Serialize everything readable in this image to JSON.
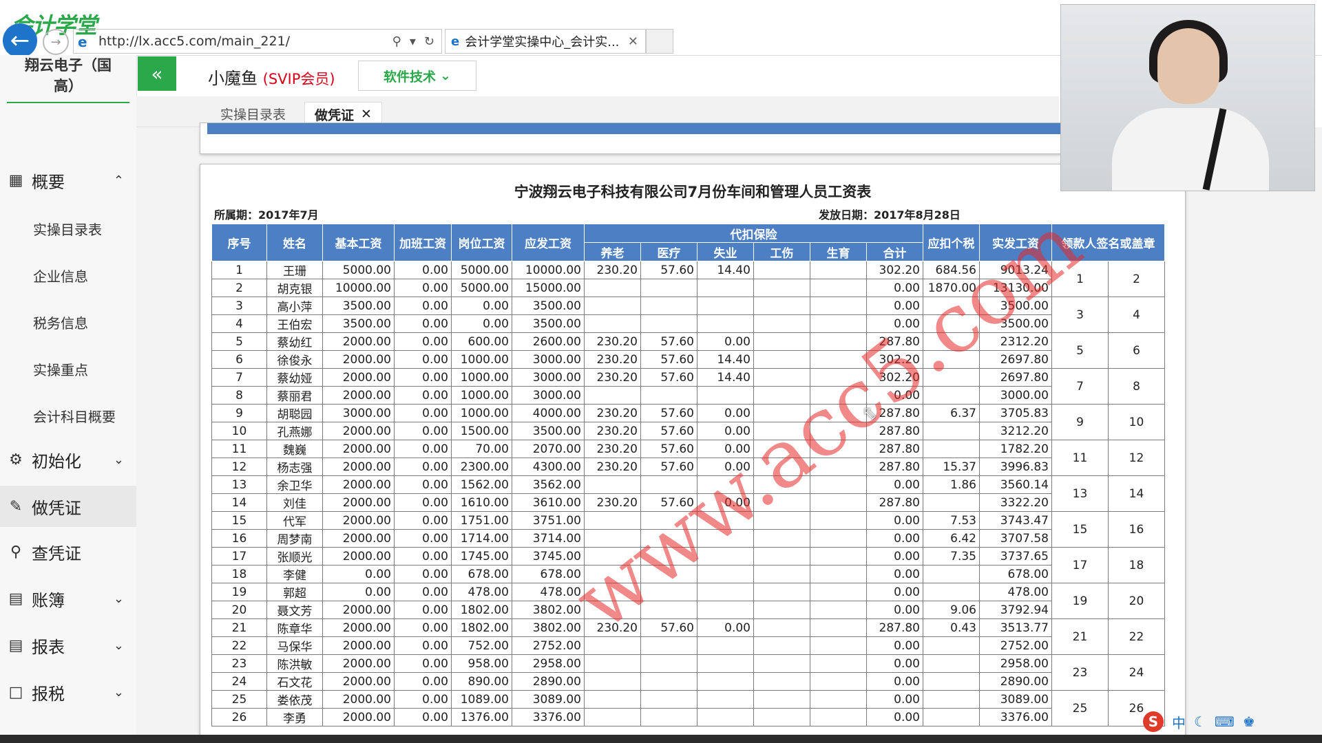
{
  "browser": {
    "logo_text": "会计学堂",
    "url": "http://lx.acc5.com/main_221/",
    "tab_title": "会计学堂实操中心_会计实...",
    "tab_close": "✕"
  },
  "sidebar": {
    "company_line1": "翔云电子（国",
    "company_line2": "高）",
    "groups": [
      {
        "label": "概要",
        "icon": "grid-icon"
      },
      {
        "label": "初始化",
        "icon": "gear-icon"
      },
      {
        "label": "做凭证",
        "icon": "pen-icon"
      },
      {
        "label": "查凭证",
        "icon": "search-icon"
      },
      {
        "label": "账簿",
        "icon": "ledger-icon"
      },
      {
        "label": "报表",
        "icon": "report-icon"
      },
      {
        "label": "报税",
        "icon": "file-icon"
      }
    ],
    "sub_items": [
      "实操目录表",
      "企业信息",
      "税务信息",
      "实操重点",
      "会计科目概要"
    ]
  },
  "header": {
    "username": "小魔鱼",
    "vip": "(SVIP会员)",
    "tech_button": "软件技术"
  },
  "tabs": {
    "catalog": "实操目录表",
    "voucher": "做凭证"
  },
  "sheet": {
    "title": "宁波翔云电子科技有限公司7月份车间和管理人员工资表",
    "period": "所属期：2017年7月",
    "pay_date": "发放日期：2017年8月28日",
    "headers": {
      "seq": "序号",
      "name": "姓名",
      "base": "基本工资",
      "overtime": "加班工资",
      "post": "岗位工资",
      "gross": "应发工资",
      "insurance": "代扣保险",
      "pension": "养老",
      "medical": "医疗",
      "unemployment": "失业",
      "injury": "工伤",
      "maternity": "生育",
      "total": "合计",
      "tax": "应扣个税",
      "net": "实发工资",
      "sign": "领款人签名或盖章"
    },
    "rows": [
      [
        "1",
        "王珊",
        "5000.00",
        "0.00",
        "5000.00",
        "10000.00",
        "230.20",
        "57.60",
        "14.40",
        "",
        "",
        "302.20",
        "684.56",
        "9013.24"
      ],
      [
        "2",
        "胡克银",
        "10000.00",
        "0.00",
        "5000.00",
        "15000.00",
        "",
        "",
        "",
        "",
        "",
        "0.00",
        "1870.00",
        "13130.00"
      ],
      [
        "3",
        "高小萍",
        "3500.00",
        "0.00",
        "0.00",
        "3500.00",
        "",
        "",
        "",
        "",
        "",
        "0.00",
        "",
        "3500.00"
      ],
      [
        "4",
        "王伯宏",
        "3500.00",
        "0.00",
        "0.00",
        "3500.00",
        "",
        "",
        "",
        "",
        "",
        "0.00",
        "",
        "3500.00"
      ],
      [
        "5",
        "蔡幼红",
        "2000.00",
        "0.00",
        "600.00",
        "2600.00",
        "230.20",
        "57.60",
        "0.00",
        "",
        "",
        "287.80",
        "",
        "2312.20"
      ],
      [
        "6",
        "徐俊永",
        "2000.00",
        "0.00",
        "1000.00",
        "3000.00",
        "230.20",
        "57.60",
        "14.40",
        "",
        "",
        "302.20",
        "",
        "2697.80"
      ],
      [
        "7",
        "蔡幼娅",
        "2000.00",
        "0.00",
        "1000.00",
        "3000.00",
        "230.20",
        "57.60",
        "14.40",
        "",
        "",
        "302.20",
        "",
        "2697.80"
      ],
      [
        "8",
        "蔡丽君",
        "2000.00",
        "0.00",
        "1000.00",
        "3000.00",
        "",
        "",
        "",
        "",
        "",
        "0.00",
        "",
        "3000.00"
      ],
      [
        "9",
        "胡聪园",
        "3000.00",
        "0.00",
        "1000.00",
        "4000.00",
        "230.20",
        "57.60",
        "0.00",
        "",
        "",
        "287.80",
        "6.37",
        "3705.83"
      ],
      [
        "10",
        "孔燕娜",
        "2000.00",
        "0.00",
        "1500.00",
        "3500.00",
        "230.20",
        "57.60",
        "0.00",
        "",
        "",
        "287.80",
        "",
        "3212.20"
      ],
      [
        "11",
        "魏巍",
        "2000.00",
        "0.00",
        "70.00",
        "2070.00",
        "230.20",
        "57.60",
        "0.00",
        "",
        "",
        "287.80",
        "",
        "1782.20"
      ],
      [
        "12",
        "杨志强",
        "2000.00",
        "0.00",
        "2300.00",
        "4300.00",
        "230.20",
        "57.60",
        "0.00",
        "",
        "",
        "287.80",
        "15.37",
        "3996.83"
      ],
      [
        "13",
        "余卫华",
        "2000.00",
        "0.00",
        "1562.00",
        "3562.00",
        "",
        "",
        "",
        "",
        "",
        "0.00",
        "1.86",
        "3560.14"
      ],
      [
        "14",
        "刘佳",
        "2000.00",
        "0.00",
        "1610.00",
        "3610.00",
        "230.20",
        "57.60",
        "0.00",
        "",
        "",
        "287.80",
        "",
        "3322.20"
      ],
      [
        "15",
        "代军",
        "2000.00",
        "0.00",
        "1751.00",
        "3751.00",
        "",
        "",
        "",
        "",
        "",
        "0.00",
        "7.53",
        "3743.47"
      ],
      [
        "16",
        "周梦南",
        "2000.00",
        "0.00",
        "1714.00",
        "3714.00",
        "",
        "",
        "",
        "",
        "",
        "0.00",
        "6.42",
        "3707.58"
      ],
      [
        "17",
        "张顺光",
        "2000.00",
        "0.00",
        "1745.00",
        "3745.00",
        "",
        "",
        "",
        "",
        "",
        "0.00",
        "7.35",
        "3737.65"
      ],
      [
        "18",
        "李健",
        "0.00",
        "0.00",
        "678.00",
        "678.00",
        "",
        "",
        "",
        "",
        "",
        "0.00",
        "",
        "678.00"
      ],
      [
        "19",
        "郭超",
        "0.00",
        "0.00",
        "478.00",
        "478.00",
        "",
        "",
        "",
        "",
        "",
        "0.00",
        "",
        "478.00"
      ],
      [
        "20",
        "聂文芳",
        "2000.00",
        "0.00",
        "1802.00",
        "3802.00",
        "",
        "",
        "",
        "",
        "",
        "0.00",
        "9.06",
        "3792.94"
      ],
      [
        "21",
        "陈章华",
        "2000.00",
        "0.00",
        "1802.00",
        "3802.00",
        "230.20",
        "57.60",
        "0.00",
        "",
        "",
        "287.80",
        "0.43",
        "3513.77"
      ],
      [
        "22",
        "马保华",
        "2000.00",
        "0.00",
        "752.00",
        "2752.00",
        "",
        "",
        "",
        "",
        "",
        "0.00",
        "",
        "2752.00"
      ],
      [
        "23",
        "陈洪敏",
        "2000.00",
        "0.00",
        "958.00",
        "2958.00",
        "",
        "",
        "",
        "",
        "",
        "0.00",
        "",
        "2958.00"
      ],
      [
        "24",
        "石文花",
        "2000.00",
        "0.00",
        "890.00",
        "2890.00",
        "",
        "",
        "",
        "",
        "",
        "0.00",
        "",
        "2890.00"
      ],
      [
        "25",
        "娄依茂",
        "2000.00",
        "0.00",
        "1089.00",
        "3089.00",
        "",
        "",
        "",
        "",
        "",
        "0.00",
        "",
        "3089.00"
      ],
      [
        "26",
        "李勇",
        "2000.00",
        "0.00",
        "1376.00",
        "3376.00",
        "",
        "",
        "",
        "",
        "",
        "0.00",
        "",
        "3376.00"
      ]
    ],
    "sign_pairs": [
      [
        "1",
        "2"
      ],
      [
        "3",
        "4"
      ],
      [
        "5",
        "6"
      ],
      [
        "7",
        "8"
      ],
      [
        "9",
        "10"
      ],
      [
        "11",
        "12"
      ],
      [
        "13",
        "14"
      ],
      [
        "15",
        "16"
      ],
      [
        "17",
        "18"
      ],
      [
        "19",
        "20"
      ],
      [
        "21",
        "22"
      ],
      [
        "23",
        "24"
      ],
      [
        "25",
        "26"
      ]
    ]
  },
  "watermark": "www.acc5.com",
  "ime": {
    "lang": "中"
  },
  "colors": {
    "accent_green": "#2aa84a",
    "table_header_blue": "#4d7fc4",
    "vip_red": "#d7001b",
    "watermark_red": "#e62828"
  }
}
